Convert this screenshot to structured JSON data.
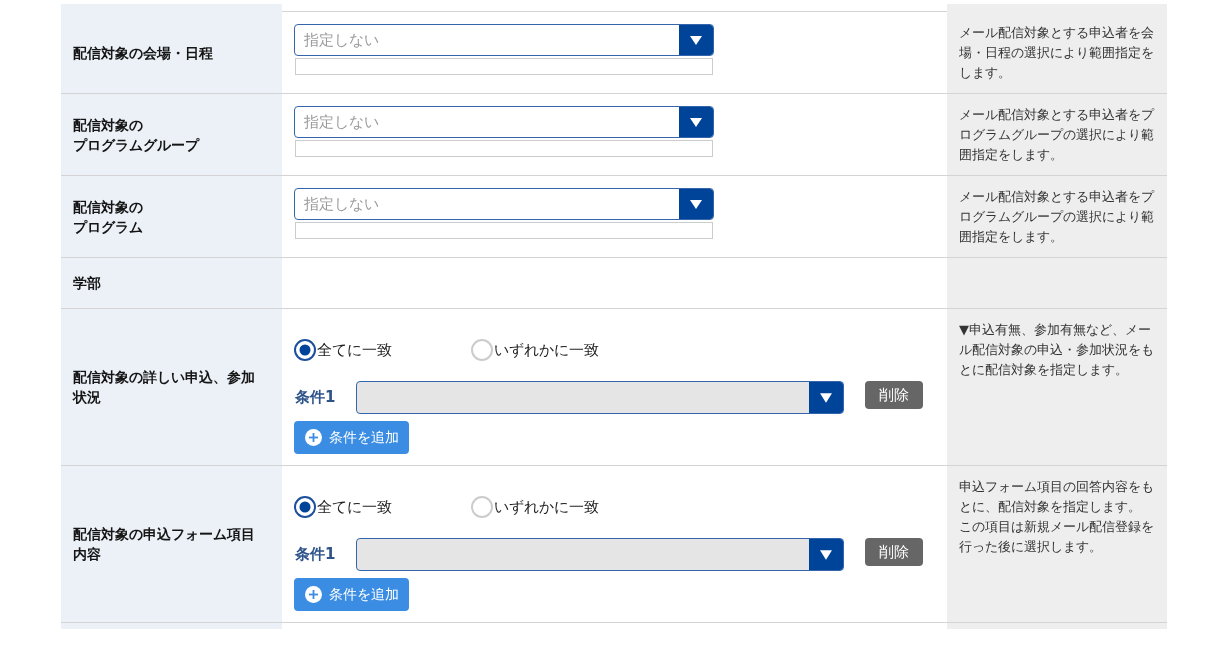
{
  "rows": [
    {
      "kind": "select",
      "label": [
        "配信対象の会場・日程"
      ],
      "select": {
        "placeholder": "指定しない"
      },
      "help": [
        "メール配信対象とする申込者を会場・日程の選択により範囲指定をします。"
      ]
    },
    {
      "kind": "select",
      "label": [
        "配信対象の",
        "プログラムグループ"
      ],
      "select": {
        "placeholder": "指定しない"
      },
      "help": [
        "メール配信対象とする申込者をプログラムグループの選択により範囲指定をします。"
      ]
    },
    {
      "kind": "select",
      "label": [
        "配信対象の",
        "プログラム"
      ],
      "select": {
        "placeholder": "指定しない"
      },
      "help": [
        "メール配信対象とする申込者をプログラムグループの選択により範囲指定をします。"
      ]
    },
    {
      "kind": "plain",
      "label": [
        "学部"
      ]
    },
    {
      "kind": "conditions",
      "label": [
        "配信対象の詳しい申込、参加状況"
      ],
      "match_options": [
        {
          "label": "全てに一致",
          "selected": true
        },
        {
          "label": "いずれかに一致",
          "selected": false
        }
      ],
      "conditions": [
        {
          "label": "条件1",
          "delete_button": "削除"
        }
      ],
      "add_button": "条件を追加",
      "help": [
        "▼申込有無、参加有無など、メール配信対象の申込・参加状況をもとに配信対象を指定します。"
      ]
    },
    {
      "kind": "conditions",
      "label": [
        "配信対象の申込フォーム項目内容"
      ],
      "match_options": [
        {
          "label": "全てに一致",
          "selected": true
        },
        {
          "label": "いずれかに一致",
          "selected": false
        }
      ],
      "conditions": [
        {
          "label": "条件1",
          "delete_button": "削除"
        }
      ],
      "add_button": "条件を追加",
      "help": [
        "申込フォーム項目の回答内容をもとに、配信対象を指定します。",
        "この項目は新規メール配信登録を行った後に選択します。"
      ]
    }
  ]
}
